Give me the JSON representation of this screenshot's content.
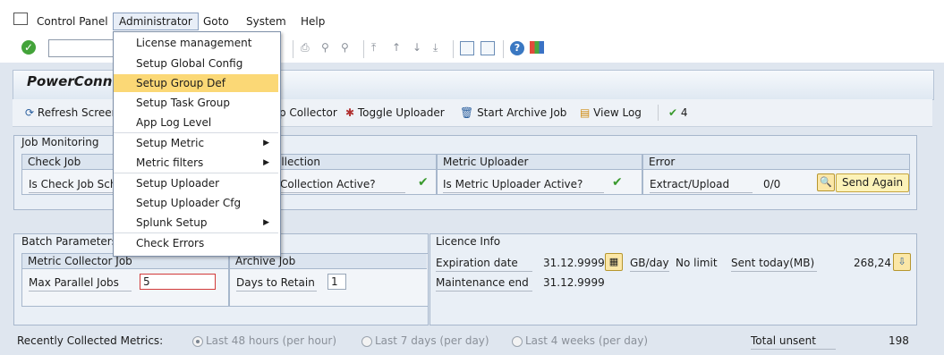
{
  "menubar": {
    "items": [
      "Control Panel",
      "Administrator",
      "Goto",
      "System",
      "Help"
    ]
  },
  "dropdown": {
    "items": [
      {
        "label": "License management",
        "submenu": false
      },
      {
        "label": "Setup Global Config",
        "submenu": false
      },
      {
        "label": "Setup Group Def",
        "submenu": false,
        "highlighted": true
      },
      {
        "label": "Setup Task Group",
        "submenu": false
      },
      {
        "label": "App Log Level",
        "submenu": false
      },
      {
        "label": "Setup Metric",
        "submenu": true
      },
      {
        "label": "Metric filters",
        "submenu": true
      },
      {
        "label": "Setup Uploader",
        "submenu": false
      },
      {
        "label": "Setup Uploader Cfg",
        "submenu": false
      },
      {
        "label": "Splunk Setup",
        "submenu": true
      },
      {
        "label": "Check Errors",
        "submenu": false
      }
    ]
  },
  "app": {
    "title": "PowerConn",
    "actions": {
      "refresh": "Refresh Screen",
      "collector": "p Collector",
      "toggle_uploader": "Toggle Uploader",
      "start_archive": "Start Archive Job",
      "view_log": "View Log",
      "count": "4"
    }
  },
  "job_monitoring": {
    "title": "Job Monitoring",
    "check_job": {
      "header": "Check Job",
      "question": "Is Check Job Sch"
    },
    "collection": {
      "header": "ollection",
      "question": "Collection Active?"
    },
    "uploader": {
      "header": "Metric Uploader",
      "question": "Is Metric Uploader Active?"
    },
    "error": {
      "header": "Error",
      "label": "Extract/Upload",
      "value": "0/0",
      "send_again": "Send Again"
    }
  },
  "batch_parameters": {
    "title": "Batch Parameters",
    "collector": {
      "header": "Metric Collector Job",
      "label": "Max Parallel Jobs",
      "value": "5"
    },
    "archive": {
      "header": "Archive Job",
      "label": "Days to Retain",
      "value": "1"
    }
  },
  "licence": {
    "title": "Licence Info",
    "expiration_label": "Expiration date",
    "expiration_value": "31.12.9999",
    "gb_label": "GB/day",
    "gb_value": "No limit",
    "sent_label": "Sent today(MB)",
    "sent_value": "268,24",
    "maint_label": "Maintenance end",
    "maint_value": "31.12.9999"
  },
  "footer": {
    "label": "Recently Collected Metrics:",
    "radio_48h": "Last 48 hours (per hour)",
    "radio_7d": "Last 7 days (per day)",
    "radio_4w": "Last 4 weeks (per day)",
    "total_label": "Total unsent",
    "total_value": "198"
  },
  "colors": {
    "highlight": "#fbd876",
    "check": "#3a9a2e",
    "background": "#dfe6ef"
  }
}
